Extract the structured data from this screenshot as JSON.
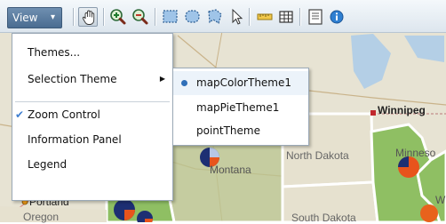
{
  "toolbar": {
    "view_label": "View",
    "tools": [
      "pan-icon",
      "zoom-in-icon",
      "zoom-out-icon",
      "rectangle-select-icon",
      "circle-select-icon",
      "polygon-select-icon",
      "pointer-icon",
      "distance-tool-icon",
      "grid-icon",
      "info-panel-icon",
      "help-icon"
    ]
  },
  "view_menu": {
    "items": [
      {
        "label": "Themes...",
        "has_submenu": false,
        "checked": false
      },
      {
        "label": "Selection Theme",
        "has_submenu": true,
        "checked": false
      },
      {
        "label": "Zoom Control",
        "has_submenu": false,
        "checked": true
      },
      {
        "label": "Information Panel",
        "has_submenu": false,
        "checked": false
      },
      {
        "label": "Legend",
        "has_submenu": false,
        "checked": false
      }
    ]
  },
  "selection_theme_submenu": {
    "items": [
      {
        "label": "mapColorTheme1",
        "selected": true
      },
      {
        "label": "mapPieTheme1",
        "selected": false
      },
      {
        "label": "pointTheme",
        "selected": false
      }
    ]
  },
  "map": {
    "labels": {
      "winnipeg": "Winnipeg",
      "montana": "Montana",
      "north_dakota": "North Dakota",
      "minnesota": "Minneso",
      "portland": "Portland",
      "oregon": "Oregon",
      "south_dakota": "South Dakota",
      "w_fragment": "W"
    },
    "colors": {
      "green": "#8fbf63",
      "land": "#e8e4d4",
      "water": "#b4cfe6",
      "pie_orange": "#e8541c",
      "pie_navy": "#1d2f73"
    }
  }
}
